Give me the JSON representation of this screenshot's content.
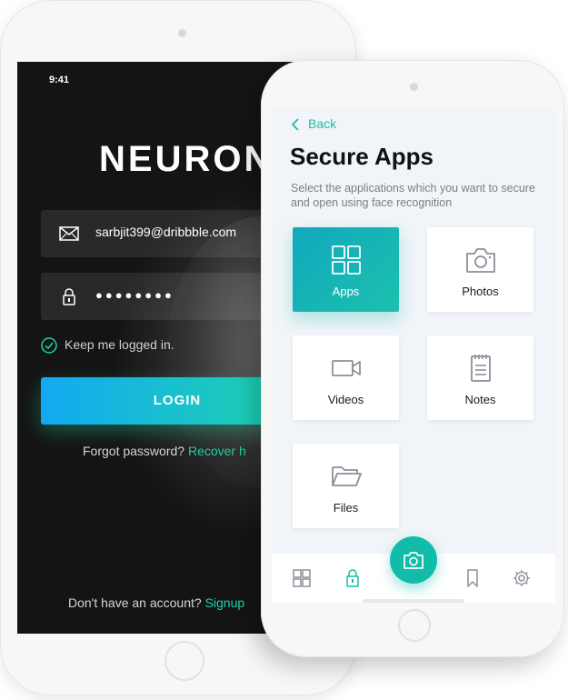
{
  "login_screen": {
    "status_time": "9:41",
    "brand_main": "NEURON",
    "brand_accent": "N",
    "email_value": "sarbjit399@dribbble.com",
    "password_value": "●●●●●●●●",
    "keep_logged_in": "Keep me logged in.",
    "login_button": "LOGIN",
    "forgot_text": "Forgot password?",
    "recover_link": "Recover h",
    "no_account_text": "Don't have an account?",
    "signup_link": "Signup",
    "accent_color": "#1fd1a6"
  },
  "apps_screen": {
    "back_label": "Back",
    "title": "Secure Apps",
    "subtitle": "Select the applications which you want to secure and open using face recognition",
    "tiles": [
      {
        "label": "Apps",
        "icon": "grid-icon",
        "active": true
      },
      {
        "label": "Photos",
        "icon": "camera-icon",
        "active": false
      },
      {
        "label": "Videos",
        "icon": "video-icon",
        "active": false
      },
      {
        "label": "Notes",
        "icon": "notes-icon",
        "active": false
      },
      {
        "label": "Files",
        "icon": "folder-icon",
        "active": false
      }
    ],
    "tabbar": {
      "tabs": [
        "grid-icon",
        "lock-icon",
        "camera-icon",
        "bookmark-icon",
        "settings-icon"
      ],
      "active_tab": "lock-icon"
    },
    "accent_color": "#13bca8"
  }
}
